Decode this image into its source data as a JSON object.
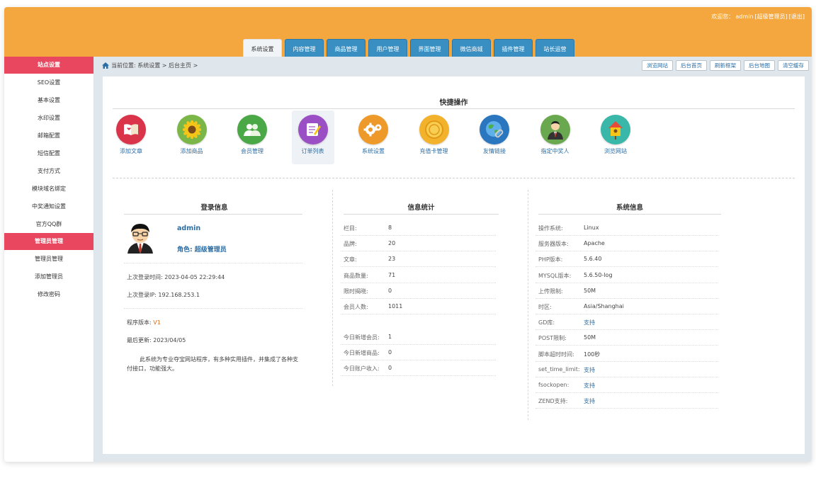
{
  "header": {
    "welcome_prefix": "欢迎您：",
    "user": "admin",
    "role_bracket": "[超级管理员]",
    "logout": "[退出]"
  },
  "nav_tabs": [
    {
      "label": "系统设置",
      "active": true
    },
    {
      "label": "内容管理",
      "active": false
    },
    {
      "label": "商品管理",
      "active": false
    },
    {
      "label": "用户管理",
      "active": false
    },
    {
      "label": "界面管理",
      "active": false
    },
    {
      "label": "微信商城",
      "active": false
    },
    {
      "label": "插件管理",
      "active": false
    },
    {
      "label": "站长运营",
      "active": false
    }
  ],
  "sidebar": {
    "items": [
      {
        "label": "站点设置",
        "head": true
      },
      {
        "label": "SEO设置",
        "head": false
      },
      {
        "label": "基本设置",
        "head": false
      },
      {
        "label": "水印设置",
        "head": false
      },
      {
        "label": "邮箱配置",
        "head": false
      },
      {
        "label": "短信配置",
        "head": false
      },
      {
        "label": "支付方式",
        "head": false
      },
      {
        "label": "模块域名绑定",
        "head": false
      },
      {
        "label": "中奖通知设置",
        "head": false
      },
      {
        "label": "官方QQ群",
        "head": false
      },
      {
        "label": "管理员管理",
        "head": true
      },
      {
        "label": "管理员管理",
        "head": false
      },
      {
        "label": "添加管理员",
        "head": false
      },
      {
        "label": "修改密码",
        "head": false
      }
    ]
  },
  "breadcrumb": "当前位置: 系统设置 > 后台主页 >",
  "crumb_buttons": [
    "浏览网站",
    "后台首页",
    "刷新框架",
    "后台地图",
    "清空缓存"
  ],
  "quick": {
    "title": "快捷操作",
    "items": [
      {
        "label": "添加文章",
        "icon": "book-icon",
        "color": "#d9344a"
      },
      {
        "label": "添加商品",
        "icon": "sunflower-icon",
        "color": "#7ab648"
      },
      {
        "label": "会员管理",
        "icon": "users-icon",
        "color": "#4aa846"
      },
      {
        "label": "订单列表",
        "icon": "notepad-icon",
        "color": "#9b4fc4"
      },
      {
        "label": "系统设置",
        "icon": "gears-icon",
        "color": "#ee9a2a"
      },
      {
        "label": "充值卡管理",
        "icon": "coin-icon",
        "color": "#f2b22b"
      },
      {
        "label": "友情链接",
        "icon": "globe-link-icon",
        "color": "#2a77c0"
      },
      {
        "label": "指定中奖人",
        "icon": "person-icon",
        "color": "#6aa84f"
      },
      {
        "label": "浏览网站",
        "icon": "birdhouse-icon",
        "color": "#39b7a8"
      }
    ]
  },
  "login": {
    "title": "登录信息",
    "username": "admin",
    "role": "角色: 超级管理员",
    "last_time": "上次登录时间: 2023-04-05 22:29:44",
    "last_ip": "上次登录IP: 192.168.253.1",
    "version_label": "程序版本: ",
    "version": "V1",
    "updated": "最后更新: 2023/04/05",
    "desc": "此系统为专业夺宝网站程序，有多种实用插件，并集成了各种支付接口，功能强大。"
  },
  "stats": {
    "title": "信息统计",
    "rows": [
      {
        "k": "栏目:",
        "v": "8"
      },
      {
        "k": "品牌:",
        "v": "20"
      },
      {
        "k": "文章:",
        "v": "23"
      },
      {
        "k": "商品数量:",
        "v": "71"
      },
      {
        "k": "限时揭晓:",
        "v": "0"
      },
      {
        "k": "会员人数:",
        "v": "1011"
      }
    ],
    "today": [
      {
        "k": "今日新增会员:",
        "v": "1"
      },
      {
        "k": "今日新增商品:",
        "v": "0"
      },
      {
        "k": "今日账户收入:",
        "v": "0"
      }
    ]
  },
  "system": {
    "title": "系统信息",
    "rows": [
      {
        "k": "操作系统:",
        "v": "Linux",
        "link": false
      },
      {
        "k": "服务器版本:",
        "v": "Apache",
        "link": false
      },
      {
        "k": "PHP版本:",
        "v": "5.6.40",
        "link": false
      },
      {
        "k": "MYSQL版本:",
        "v": "5.6.50-log",
        "link": false
      },
      {
        "k": "上传限制:",
        "v": "50M",
        "link": false
      },
      {
        "k": "时区:",
        "v": "Asia/Shanghai",
        "link": false
      },
      {
        "k": "GD库:",
        "v": "支持",
        "link": true
      },
      {
        "k": "POST限制:",
        "v": "50M",
        "link": false
      },
      {
        "k": "脚本超时时间:",
        "v": "100秒",
        "link": false
      },
      {
        "k": "set_time_limit:",
        "v": "支持",
        "link": true
      },
      {
        "k": "fsockopen:",
        "v": "支持",
        "link": true
      },
      {
        "k": "ZEND支持:",
        "v": "支持",
        "link": true
      }
    ]
  }
}
